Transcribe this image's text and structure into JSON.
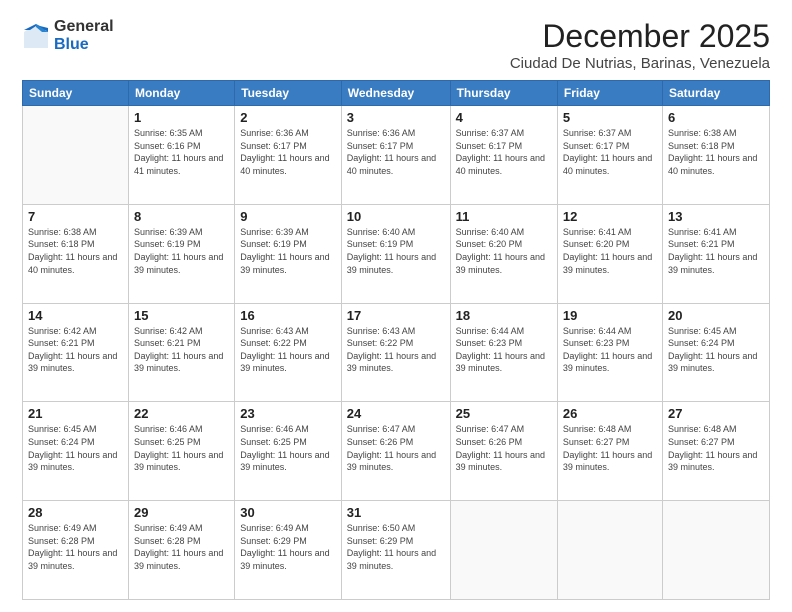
{
  "logo": {
    "general": "General",
    "blue": "Blue"
  },
  "header": {
    "month": "December 2025",
    "location": "Ciudad De Nutrias, Barinas, Venezuela"
  },
  "weekdays": [
    "Sunday",
    "Monday",
    "Tuesday",
    "Wednesday",
    "Thursday",
    "Friday",
    "Saturday"
  ],
  "weeks": [
    [
      {
        "day": "",
        "sunrise": "",
        "sunset": "",
        "daylight": ""
      },
      {
        "day": "1",
        "sunrise": "6:35 AM",
        "sunset": "6:16 PM",
        "daylight": "11 hours and 41 minutes."
      },
      {
        "day": "2",
        "sunrise": "6:36 AM",
        "sunset": "6:17 PM",
        "daylight": "11 hours and 40 minutes."
      },
      {
        "day": "3",
        "sunrise": "6:36 AM",
        "sunset": "6:17 PM",
        "daylight": "11 hours and 40 minutes."
      },
      {
        "day": "4",
        "sunrise": "6:37 AM",
        "sunset": "6:17 PM",
        "daylight": "11 hours and 40 minutes."
      },
      {
        "day": "5",
        "sunrise": "6:37 AM",
        "sunset": "6:17 PM",
        "daylight": "11 hours and 40 minutes."
      },
      {
        "day": "6",
        "sunrise": "6:38 AM",
        "sunset": "6:18 PM",
        "daylight": "11 hours and 40 minutes."
      }
    ],
    [
      {
        "day": "7",
        "sunrise": "6:38 AM",
        "sunset": "6:18 PM",
        "daylight": "11 hours and 40 minutes."
      },
      {
        "day": "8",
        "sunrise": "6:39 AM",
        "sunset": "6:19 PM",
        "daylight": "11 hours and 39 minutes."
      },
      {
        "day": "9",
        "sunrise": "6:39 AM",
        "sunset": "6:19 PM",
        "daylight": "11 hours and 39 minutes."
      },
      {
        "day": "10",
        "sunrise": "6:40 AM",
        "sunset": "6:19 PM",
        "daylight": "11 hours and 39 minutes."
      },
      {
        "day": "11",
        "sunrise": "6:40 AM",
        "sunset": "6:20 PM",
        "daylight": "11 hours and 39 minutes."
      },
      {
        "day": "12",
        "sunrise": "6:41 AM",
        "sunset": "6:20 PM",
        "daylight": "11 hours and 39 minutes."
      },
      {
        "day": "13",
        "sunrise": "6:41 AM",
        "sunset": "6:21 PM",
        "daylight": "11 hours and 39 minutes."
      }
    ],
    [
      {
        "day": "14",
        "sunrise": "6:42 AM",
        "sunset": "6:21 PM",
        "daylight": "11 hours and 39 minutes."
      },
      {
        "day": "15",
        "sunrise": "6:42 AM",
        "sunset": "6:21 PM",
        "daylight": "11 hours and 39 minutes."
      },
      {
        "day": "16",
        "sunrise": "6:43 AM",
        "sunset": "6:22 PM",
        "daylight": "11 hours and 39 minutes."
      },
      {
        "day": "17",
        "sunrise": "6:43 AM",
        "sunset": "6:22 PM",
        "daylight": "11 hours and 39 minutes."
      },
      {
        "day": "18",
        "sunrise": "6:44 AM",
        "sunset": "6:23 PM",
        "daylight": "11 hours and 39 minutes."
      },
      {
        "day": "19",
        "sunrise": "6:44 AM",
        "sunset": "6:23 PM",
        "daylight": "11 hours and 39 minutes."
      },
      {
        "day": "20",
        "sunrise": "6:45 AM",
        "sunset": "6:24 PM",
        "daylight": "11 hours and 39 minutes."
      }
    ],
    [
      {
        "day": "21",
        "sunrise": "6:45 AM",
        "sunset": "6:24 PM",
        "daylight": "11 hours and 39 minutes."
      },
      {
        "day": "22",
        "sunrise": "6:46 AM",
        "sunset": "6:25 PM",
        "daylight": "11 hours and 39 minutes."
      },
      {
        "day": "23",
        "sunrise": "6:46 AM",
        "sunset": "6:25 PM",
        "daylight": "11 hours and 39 minutes."
      },
      {
        "day": "24",
        "sunrise": "6:47 AM",
        "sunset": "6:26 PM",
        "daylight": "11 hours and 39 minutes."
      },
      {
        "day": "25",
        "sunrise": "6:47 AM",
        "sunset": "6:26 PM",
        "daylight": "11 hours and 39 minutes."
      },
      {
        "day": "26",
        "sunrise": "6:48 AM",
        "sunset": "6:27 PM",
        "daylight": "11 hours and 39 minutes."
      },
      {
        "day": "27",
        "sunrise": "6:48 AM",
        "sunset": "6:27 PM",
        "daylight": "11 hours and 39 minutes."
      }
    ],
    [
      {
        "day": "28",
        "sunrise": "6:49 AM",
        "sunset": "6:28 PM",
        "daylight": "11 hours and 39 minutes."
      },
      {
        "day": "29",
        "sunrise": "6:49 AM",
        "sunset": "6:28 PM",
        "daylight": "11 hours and 39 minutes."
      },
      {
        "day": "30",
        "sunrise": "6:49 AM",
        "sunset": "6:29 PM",
        "daylight": "11 hours and 39 minutes."
      },
      {
        "day": "31",
        "sunrise": "6:50 AM",
        "sunset": "6:29 PM",
        "daylight": "11 hours and 39 minutes."
      },
      {
        "day": "",
        "sunrise": "",
        "sunset": "",
        "daylight": ""
      },
      {
        "day": "",
        "sunrise": "",
        "sunset": "",
        "daylight": ""
      },
      {
        "day": "",
        "sunrise": "",
        "sunset": "",
        "daylight": ""
      }
    ]
  ],
  "labels": {
    "sunrise": "Sunrise:",
    "sunset": "Sunset:",
    "daylight": "Daylight:"
  }
}
